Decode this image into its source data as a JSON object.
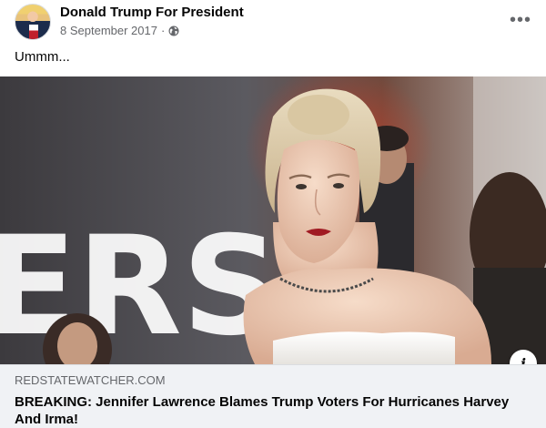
{
  "post": {
    "page_name": "Donald Trump For President",
    "date": "8 September 2017",
    "separator": "·",
    "privacy_icon": "globe-icon",
    "more_icon": "more-options-icon",
    "more_label": "•••",
    "caption": "Ummm..."
  },
  "link_preview": {
    "domain": "REDSTATEWATCHER.COM",
    "title": "BREAKING: Jennifer Lawrence Blames Trump Voters For Hurricanes Harvey And Irma!",
    "info_label": "i",
    "image_backdrop_text": "ERS"
  },
  "colors": {
    "text_primary": "#050505",
    "text_secondary": "#65676b",
    "footer_bg": "#f0f2f5",
    "dress": "#f4f2ee",
    "lipstick": "#a01a22"
  }
}
